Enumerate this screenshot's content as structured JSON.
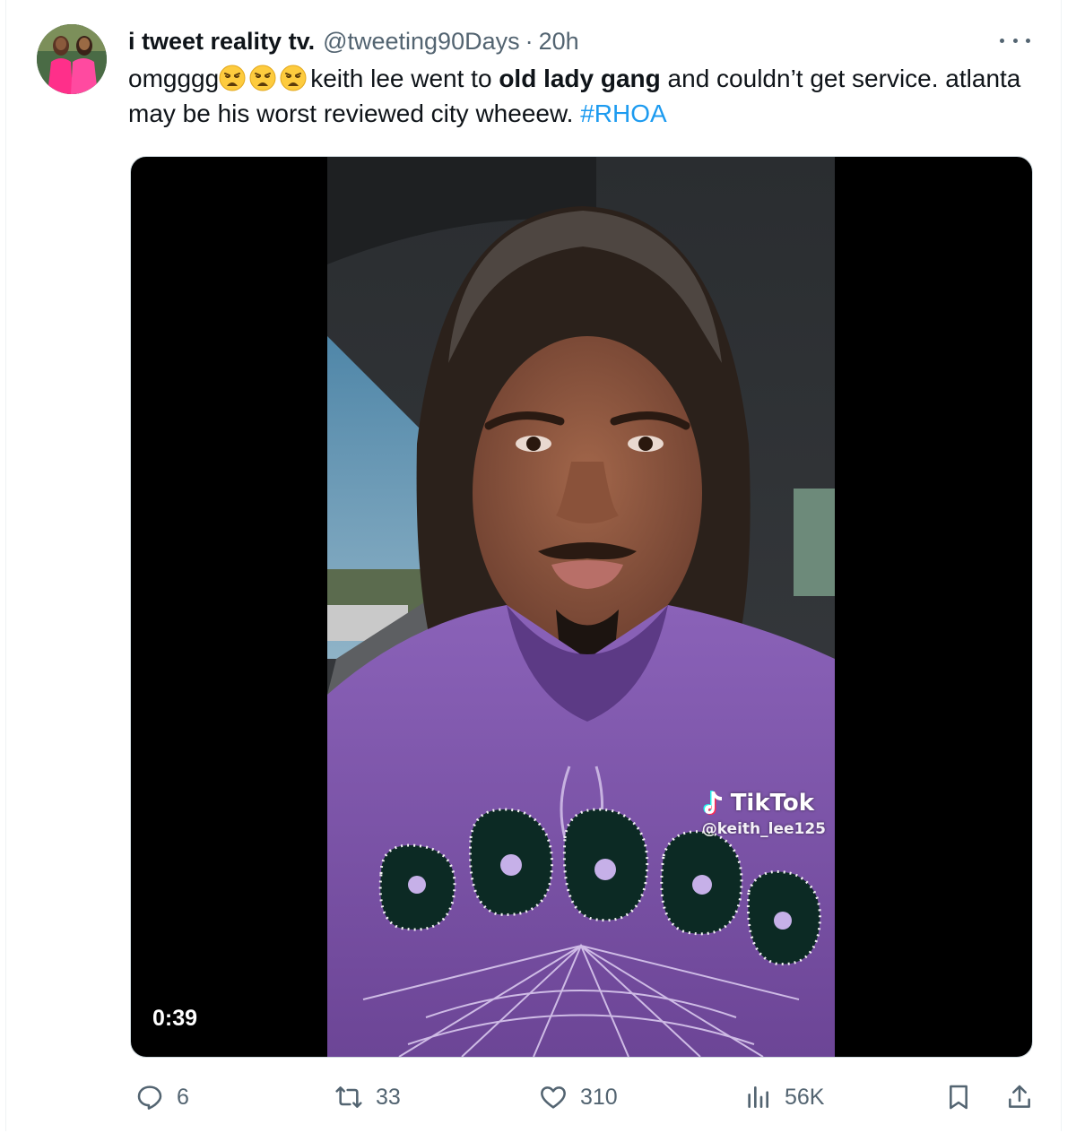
{
  "tweet": {
    "display_name": "i tweet reality tv.",
    "handle": "@tweeting90Days",
    "separator": "·",
    "time": "20h",
    "text_before_emoji": "omgggg",
    "emoji": [
      "😩",
      "😩",
      "😩"
    ],
    "text_mid": "keith lee went to ",
    "text_bold": "old lady gang",
    "text_after": " and couldn’t get service. atlanta may be his worst reviewed city wheeew. ",
    "hashtag": "#RHOA"
  },
  "media": {
    "duration": "0:39",
    "watermark_brand": "TikTok",
    "watermark_user": "@keith_lee125"
  },
  "actions": {
    "replies": "6",
    "retweets": "33",
    "likes": "310",
    "views": "56K"
  },
  "icons": {
    "reply": "reply-bubble-icon",
    "retweet": "retweet-icon",
    "like": "heart-icon",
    "views": "analytics-bars-icon",
    "bookmark": "bookmark-icon",
    "share": "share-upload-icon",
    "more": "more-dots-icon"
  },
  "colors": {
    "text": "#0f1419",
    "secondary": "#536471",
    "link": "#1d9bf0",
    "hoodie": "#7a55a8"
  }
}
